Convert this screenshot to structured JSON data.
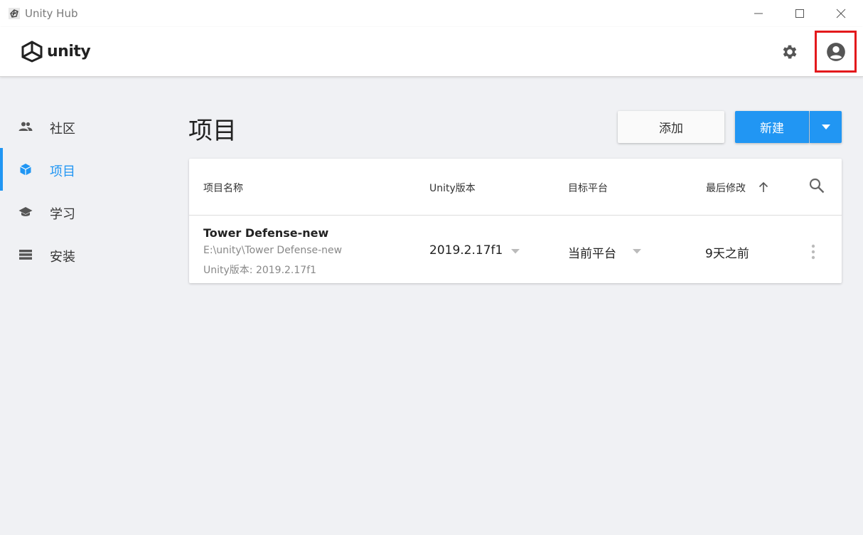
{
  "window": {
    "title": "Unity Hub"
  },
  "header": {
    "logo_text": "unity"
  },
  "sidebar": {
    "items": [
      {
        "label": "社区",
        "icon": "people-icon",
        "active": false
      },
      {
        "label": "项目",
        "icon": "cube-icon",
        "active": true
      },
      {
        "label": "学习",
        "icon": "graduation-cap-icon",
        "active": false
      },
      {
        "label": "安装",
        "icon": "list-icon",
        "active": false
      }
    ]
  },
  "main": {
    "title": "项目",
    "add_label": "添加",
    "new_label": "新建",
    "table": {
      "columns": [
        "项目名称",
        "Unity版本",
        "目标平台",
        "最后修改"
      ],
      "rows": [
        {
          "name": "Tower Defense-new",
          "path": "E:\\unity\\Tower Defense-new",
          "version_line": "Unity版本: 2019.2.17f1",
          "version": "2019.2.17f1",
          "platform": "当前平台",
          "modified": "9天之前"
        }
      ]
    }
  },
  "colors": {
    "accent": "#2196f3",
    "highlight": "#e3191c"
  }
}
